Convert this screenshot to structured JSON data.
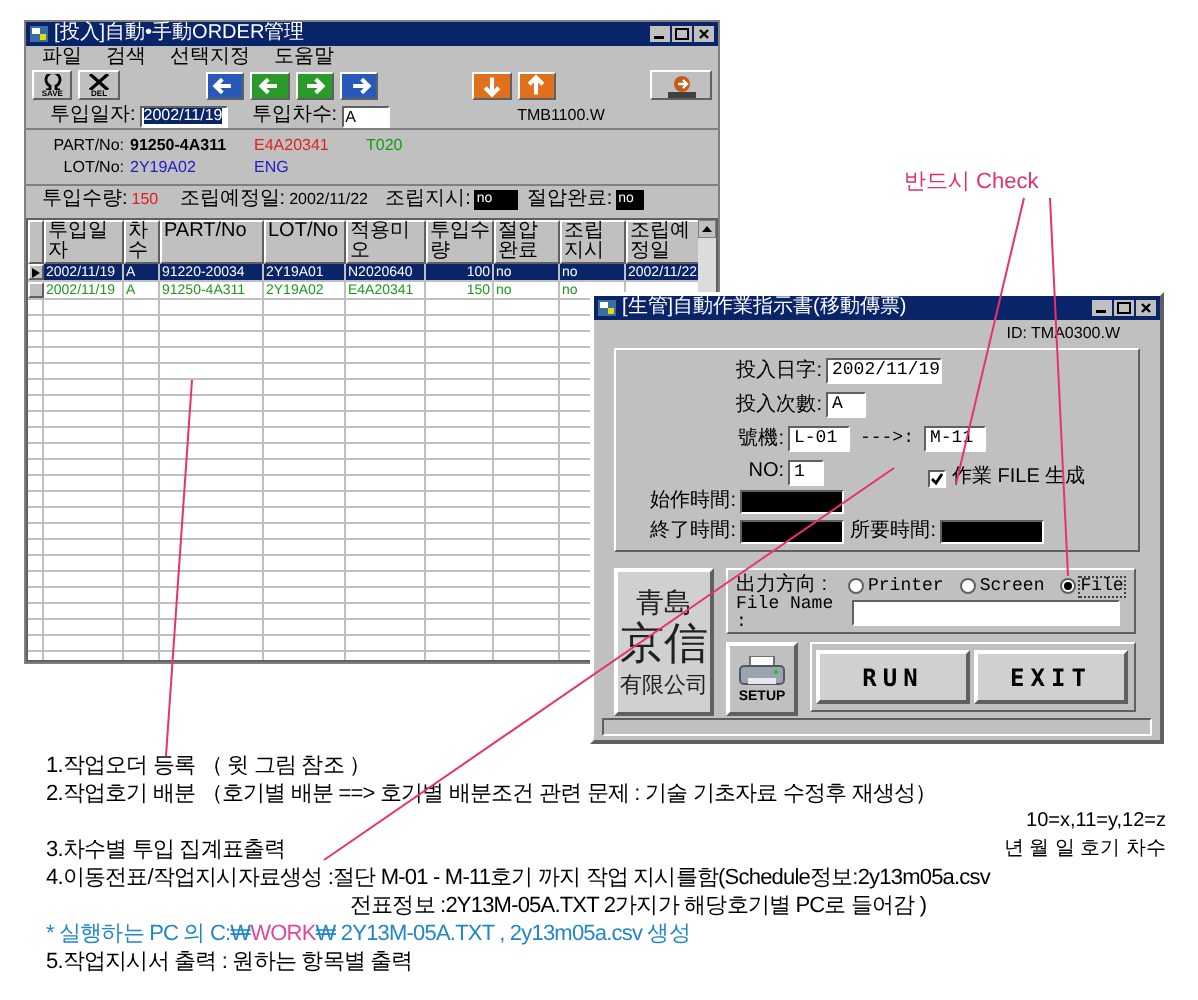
{
  "order_window": {
    "title": "[投入]自動•手動ORDER管理",
    "menu": [
      "파일",
      "검색",
      "선택지정",
      "도움말"
    ],
    "toolbar": [
      {
        "kind": "save",
        "label": "SAVE"
      },
      {
        "kind": "delete",
        "label": "DEL"
      },
      {
        "kind": "first"
      },
      {
        "kind": "prev"
      },
      {
        "kind": "next"
      },
      {
        "kind": "last"
      },
      {
        "kind": "down"
      },
      {
        "kind": "up"
      },
      {
        "kind": "exit"
      }
    ],
    "input_date": {
      "label": "투입일자:",
      "value": "2002/11/19",
      "selected": true
    },
    "batch": {
      "label": "투입차수:",
      "value": "A"
    },
    "screen_id": "TMB1100.W",
    "part": {
      "label": "PART/No:",
      "value": "91250-4A311",
      "code": "E4A20341",
      "type": "T020"
    },
    "lot": {
      "label": "LOT/No:",
      "value": "2Y19A02",
      "line": "ENG"
    },
    "quantity": {
      "label": "투입수량:",
      "value": "150"
    },
    "assembly_date": {
      "label": "조립예정일:",
      "value": "2002/11/22"
    },
    "assembly_order": {
      "label": "조립지시:",
      "value": "no"
    },
    "cut_done": {
      "label": "절압완료:",
      "value": "no"
    },
    "table": {
      "columns": [
        "투입일자",
        "차수",
        "PART/No",
        "LOT/No",
        "적용미오",
        "투입수량",
        "절압완료",
        "조립지시",
        "조립예정일"
      ],
      "rows": [
        {
          "selected": true,
          "cells": [
            "2002/11/19",
            "A",
            "91220-20034",
            "2Y19A01",
            "N2020640",
            "100",
            "no",
            "no",
            "2002/11/22"
          ]
        },
        {
          "selected": false,
          "color": "#1a9a1a",
          "cells": [
            "2002/11/19",
            "A",
            "91250-4A311",
            "2Y19A02",
            "E4A20341",
            "150",
            "no",
            "no"
          ]
        }
      ]
    }
  },
  "dialog": {
    "title": "[生管]自動作業指示書(移動傳票)",
    "screen_id": "ID: TMA0300.W",
    "input_date": {
      "label": "投入日字:",
      "value": "2002/11/19"
    },
    "batch": {
      "label": "投入次數:",
      "value": "A"
    },
    "machine": {
      "label": "號機:",
      "from": "L-01",
      "arrow": "--->:",
      "to": "M-11"
    },
    "number": {
      "label": "NO:",
      "value": "1"
    },
    "create_file": {
      "label": "作業 FILE 生成",
      "checked": true
    },
    "start_time": "始作時間:",
    "end_time": "終了時間:",
    "elapsed_time": "所要時間:",
    "logo": [
      "青島",
      "京信",
      "有限公司"
    ],
    "output": {
      "label": "出力方向 :",
      "options": [
        {
          "label": "Printer",
          "selected": false
        },
        {
          "label": "Screen",
          "selected": false
        },
        {
          "label": "File",
          "selected": true
        }
      ]
    },
    "file_name": {
      "label": "File Name :"
    },
    "setup": "SETUP",
    "run": "RUN",
    "exit": "EXIT"
  },
  "annotation": "반드시 Check",
  "notes": [
    {
      "kind": "plain",
      "text": "1.작업오더 등록 （ 윗 그림 참조 ）"
    },
    {
      "kind": "plain",
      "text": "2.작업호기 배분 （호기별 배분 ==> 호기별 배분조건 관련 문제 : 기술 기초자료 수정후 재생성）"
    },
    {
      "kind": "plain",
      "side": "10=x,11=y,12=z"
    },
    {
      "kind": "plain",
      "text": "3.차수별 투입 집계표출력",
      "side": "년 월 일 호기 차수"
    },
    {
      "kind": "plain",
      "text": "4.이동전표/작업지시자료생성 :절단 M-01 - M-11호기 까지 작업 지시를함(Schedule정보:2y13m05a.csv"
    },
    {
      "kind": "continuation",
      "text": "전표정보 :2Y13M-05A.TXT 2가지가 해당호기별 PC로 들어감 )"
    },
    {
      "kind": "highlight",
      "parts": [
        {
          "text": "* 실행하는 PC 의 C:₩",
          "color": "#1f86c8"
        },
        {
          "text": "WORK",
          "color": "#e0479a"
        },
        {
          "text": "₩ 2Y13M-05A.TXT , 2y13m05a.csv 생성",
          "color": "#1f86c8"
        }
      ]
    },
    {
      "kind": "plain",
      "text": "5.작업지시서 출력 : 원하는 항목별 출력"
    }
  ]
}
